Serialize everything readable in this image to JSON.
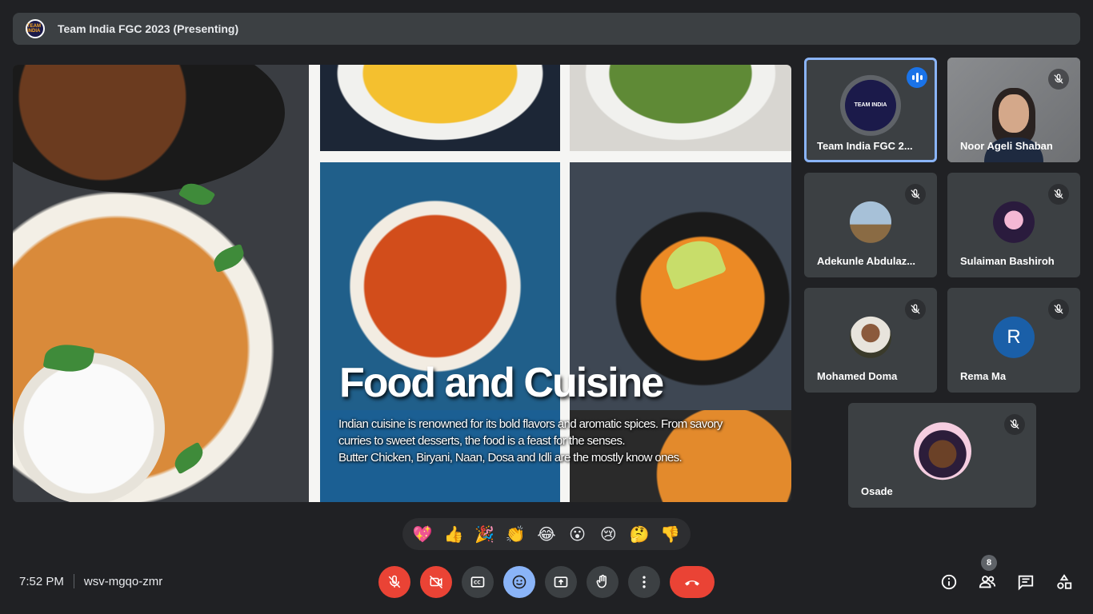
{
  "meeting": {
    "title": "Team India FGC 2023 (Presenting)",
    "time": "7:52 PM",
    "code": "wsv-mgqo-zmr",
    "participant_count": "8",
    "logo_text": "TEAM INDIA"
  },
  "slide": {
    "title": "Food and Cuisine",
    "body_line1": "Indian cuisine is renowned for its bold flavors and aromatic spices. From savory",
    "body_line2": "curries to sweet desserts, the food is a feast for the senses.",
    "body_line3": "Butter Chicken, Biryani, Naan, Dosa and Idli are the mostly know ones."
  },
  "participants": [
    {
      "name": "Team India FGC 2...",
      "speaking": true,
      "avatar": "team-logo"
    },
    {
      "name": "Noor Ageli Shaban",
      "muted": true,
      "avatar": "video"
    },
    {
      "name": "Adekunle Abdulaz...",
      "muted": true,
      "avatar": "photo"
    },
    {
      "name": "Sulaiman Bashiroh",
      "muted": true,
      "avatar": "photo"
    },
    {
      "name": "Mohamed Doma",
      "muted": true,
      "avatar": "photo"
    },
    {
      "name": "Rema Ma",
      "muted": true,
      "avatar": "letter",
      "letter": "R",
      "color": "#1a73e8"
    },
    {
      "name": "Osade",
      "muted": true,
      "avatar": "photo"
    }
  ],
  "reactions": [
    "💖",
    "👍",
    "🎉",
    "👏",
    "😂",
    "😮",
    "😢",
    "🤔",
    "👎"
  ],
  "colors": {
    "background": "#202124",
    "tile": "#3c4043",
    "accent": "#8ab4f8",
    "danger": "#ea4335"
  }
}
